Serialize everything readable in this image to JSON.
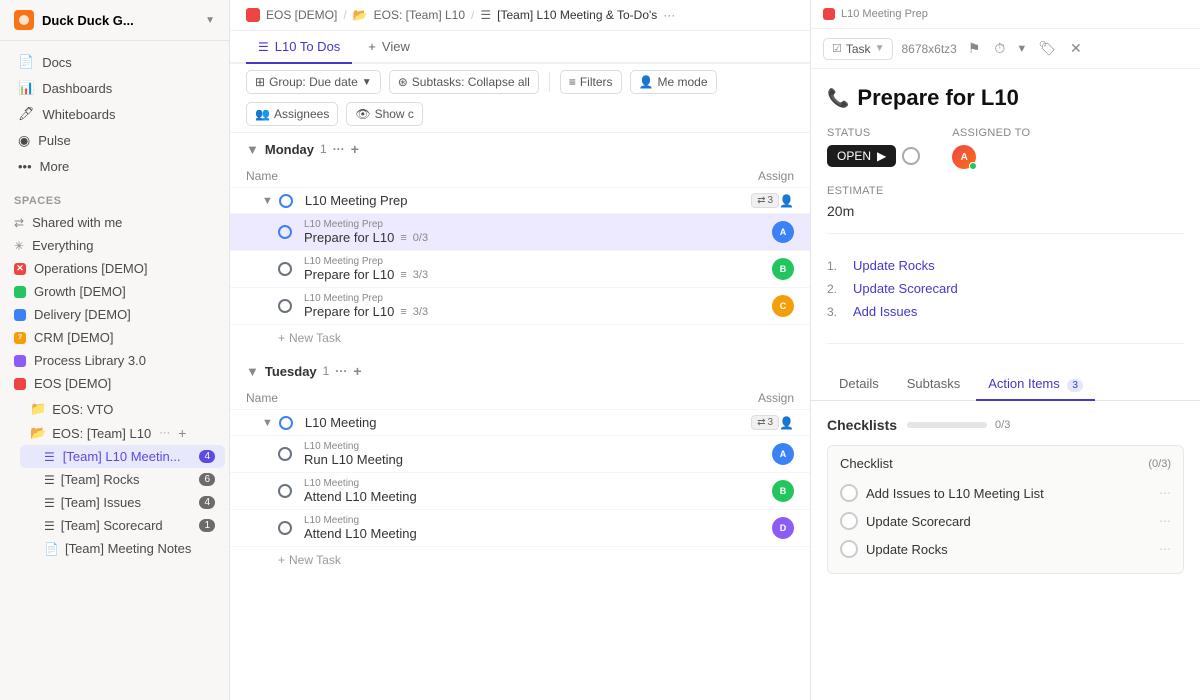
{
  "workspace": {
    "name": "Duck Duck G...",
    "icon_bg": "#f97316"
  },
  "sidebar": {
    "nav_items": [
      {
        "id": "docs",
        "label": "Docs",
        "icon": "📄"
      },
      {
        "id": "dashboards",
        "label": "Dashboards",
        "icon": "📊"
      },
      {
        "id": "whiteboards",
        "label": "Whiteboards",
        "icon": "🖊"
      },
      {
        "id": "pulse",
        "label": "Pulse",
        "icon": "📡"
      },
      {
        "id": "more",
        "label": "More",
        "icon": "···"
      }
    ],
    "spaces_label": "Spaces",
    "spaces": [
      {
        "id": "shared",
        "label": "Shared with me",
        "icon": "share"
      },
      {
        "id": "everything",
        "label": "Everything",
        "icon": "asterisk"
      },
      {
        "id": "operations",
        "label": "Operations [DEMO]",
        "icon": "x-red"
      },
      {
        "id": "growth",
        "label": "Growth [DEMO]",
        "icon": "chart-green"
      },
      {
        "id": "delivery",
        "label": "Delivery [DEMO]",
        "icon": "truck-blue"
      },
      {
        "id": "crm",
        "label": "CRM [DEMO]",
        "icon": "crm-yellow"
      },
      {
        "id": "process-lib",
        "label": "Process Library 3.0",
        "icon": "lib-purple"
      },
      {
        "id": "eos-demo",
        "label": "EOS [DEMO]",
        "icon": "eos-red"
      }
    ],
    "eos_children": [
      {
        "id": "eos-vto",
        "label": "EOS: VTO",
        "icon": "📁",
        "type": "folder"
      },
      {
        "id": "eos-team-l10",
        "label": "EOS: [Team] L10",
        "icon": "📂",
        "type": "folder",
        "has_more": true
      },
      {
        "id": "team-l10-meeting",
        "label": "[Team] L10 Meetin...",
        "icon": "list",
        "active": true,
        "badge": "4"
      },
      {
        "id": "team-rocks",
        "label": "[Team] Rocks",
        "icon": "list",
        "badge": "6"
      },
      {
        "id": "team-issues",
        "label": "[Team] Issues",
        "icon": "list",
        "badge": "4"
      },
      {
        "id": "team-scorecard",
        "label": "[Team] Scorecard",
        "icon": "list",
        "badge": "1"
      },
      {
        "id": "team-meeting-notes",
        "label": "[Team] Meeting Notes",
        "icon": "doc"
      }
    ]
  },
  "breadcrumb": {
    "items": [
      "EOS [DEMO]",
      "EOS: [Team] L10",
      "[Team] L10 Meeting & To-Do's"
    ],
    "more": "···"
  },
  "tabs": {
    "active": "L10 To Dos",
    "items": [
      "L10 To Dos",
      "+ View"
    ]
  },
  "toolbar": {
    "group_btn": "Group: Due date",
    "subtasks_btn": "Subtasks: Collapse all",
    "filters_btn": "Filters",
    "me_mode_btn": "Me mode",
    "assignees_btn": "Assignees",
    "show_btn": "Show c"
  },
  "sections": [
    {
      "id": "monday",
      "title": "Monday",
      "count": "1",
      "tasks": [
        {
          "id": "l10-meeting-prep-group",
          "name": "L10 Meeting Prep",
          "subtask_count": "3",
          "is_group": true,
          "subtasks": [
            {
              "id": "prepare-l10-1",
              "parent": "L10 Meeting Prep",
              "name": "Prepare for L10",
              "checklist": "0/3",
              "avatar_class": "av1",
              "active": true
            },
            {
              "id": "prepare-l10-2",
              "parent": "L10 Meeting Prep",
              "name": "Prepare for L10",
              "checklist": "3/3",
              "avatar_class": "av2"
            },
            {
              "id": "prepare-l10-3",
              "parent": "L10 Meeting Prep",
              "name": "Prepare for L10",
              "checklist": "3/3",
              "avatar_class": "av3"
            }
          ]
        }
      ],
      "add_task_label": "New Task"
    },
    {
      "id": "tuesday",
      "title": "Tuesday",
      "count": "1",
      "tasks": [
        {
          "id": "l10-meeting-group",
          "name": "L10 Meeting",
          "subtask_count": "3",
          "is_group": true,
          "subtasks": [
            {
              "id": "run-l10-meeting",
              "parent": "L10 Meeting",
              "name": "Run L10 Meeting",
              "avatar_class": "av1"
            },
            {
              "id": "attend-l10-1",
              "parent": "L10 Meeting",
              "name": "Attend L10 Meeting",
              "avatar_class": "av2"
            },
            {
              "id": "attend-l10-2",
              "parent": "L10 Meeting",
              "name": "Attend L10 Meeting",
              "avatar_class": "av4"
            }
          ]
        }
      ],
      "add_task_label": "New Task"
    }
  ],
  "right_panel": {
    "topbar": {
      "task_type": "Task",
      "task_id": "8678x6tz3",
      "icons": [
        "flag",
        "clock",
        "tag",
        "close"
      ]
    },
    "title": "Prepare for L10",
    "status": {
      "label": "OPEN",
      "arrow_label": "▶"
    },
    "assigned_to_label": "Assigned to",
    "status_label": "Status",
    "estimate_label": "Estimate",
    "estimate_value": "20m",
    "ordered_list": [
      {
        "num": "1.",
        "text": "Update Rocks"
      },
      {
        "num": "2.",
        "text": "Update Scorecard"
      },
      {
        "num": "3.",
        "text": "Add Issues"
      }
    ],
    "panel_tabs": [
      {
        "id": "details",
        "label": "Details"
      },
      {
        "id": "subtasks",
        "label": "Subtasks"
      },
      {
        "id": "action-items",
        "label": "Action Items",
        "badge": "3"
      }
    ],
    "checklists_section": {
      "label": "Checklists",
      "progress_text": "0/3",
      "checklist": {
        "title": "Checklist",
        "count": "(0/3)",
        "items": [
          {
            "id": "item1",
            "text": "Add Issues to L10 Meeting List"
          },
          {
            "id": "item2",
            "text": "Update Scorecard"
          },
          {
            "id": "item3",
            "text": "Update Rocks"
          }
        ]
      }
    }
  }
}
